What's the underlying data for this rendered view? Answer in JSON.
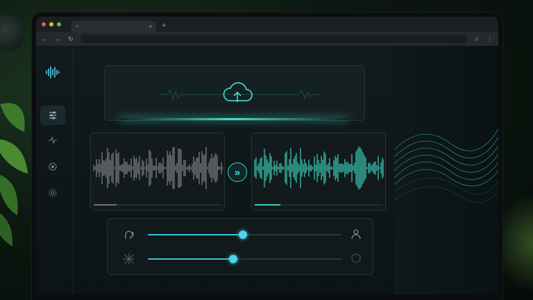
{
  "browser": {
    "tab_icon": "search-icon",
    "tab_close": "×",
    "new_tab": "+",
    "nav": {
      "back": "←",
      "forward": "→",
      "reload": "↻",
      "bookmark": "☆",
      "menu": "⋮"
    }
  },
  "sidebar": {
    "logo_icon": "waveform-logo-icon",
    "items": [
      {
        "icon": "sliders-icon",
        "active": true
      },
      {
        "icon": "pulse-icon",
        "active": false
      },
      {
        "icon": "record-icon",
        "active": false
      },
      {
        "icon": "gear-icon",
        "active": false
      }
    ]
  },
  "upload": {
    "icon": "cloud-upload-icon"
  },
  "original_audio": {
    "progress": 0.18,
    "color": "#8a8e90"
  },
  "converted_audio": {
    "progress": 0.2,
    "color": "#3fe3c9"
  },
  "convert_button": {
    "label": "»"
  },
  "controls": {
    "voice_slider": {
      "lead_icon": "voice-head-icon",
      "trail_icon": "user-icon",
      "value": 0.49
    },
    "effect_slider": {
      "lead_icon": "sparkle-icon",
      "trail_icon": "dotted-circle-icon",
      "value": 0.44
    }
  },
  "colors": {
    "accent": "#3ad3c4",
    "slider": "#35c4d8",
    "background": "#0e1315"
  }
}
